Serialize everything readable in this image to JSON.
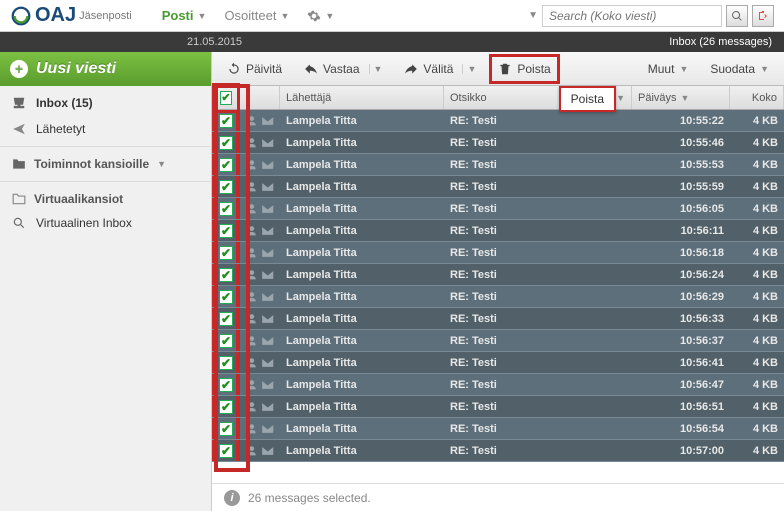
{
  "brand": {
    "name": "OAJ",
    "sub": "Jäsenposti"
  },
  "topnav": {
    "mail": "Posti",
    "contacts": "Osoitteet"
  },
  "search": {
    "placeholder": "Search (Koko viesti)"
  },
  "datebar": {
    "date": "21.05.2015",
    "status": "Inbox (26 messages)"
  },
  "compose": "Uusi viesti",
  "folders": {
    "inbox": "Inbox (15)",
    "sent": "Lähetetyt"
  },
  "sections": {
    "ops": "Toiminnot kansioille",
    "virt": "Virtuaalikansiot",
    "virt_inbox": "Virtuaalinen Inbox"
  },
  "toolbar": {
    "refresh": "Päivitä",
    "reply": "Vastaa",
    "forward": "Välitä",
    "delete": "Poista",
    "other": "Muut",
    "filter": "Suodata",
    "delete_tooltip": "Poista"
  },
  "grid": {
    "headers": {
      "from": "Lähettäjä",
      "subject": "Otsikko",
      "date": "Päiväys",
      "size": "Koko"
    },
    "rows": [
      {
        "from": "Lampela Titta",
        "subject": "RE: Testi",
        "date": "10:55:22",
        "size": "4 KB"
      },
      {
        "from": "Lampela Titta",
        "subject": "RE: Testi",
        "date": "10:55:46",
        "size": "4 KB"
      },
      {
        "from": "Lampela Titta",
        "subject": "RE: Testi",
        "date": "10:55:53",
        "size": "4 KB"
      },
      {
        "from": "Lampela Titta",
        "subject": "RE: Testi",
        "date": "10:55:59",
        "size": "4 KB"
      },
      {
        "from": "Lampela Titta",
        "subject": "RE: Testi",
        "date": "10:56:05",
        "size": "4 KB"
      },
      {
        "from": "Lampela Titta",
        "subject": "RE: Testi",
        "date": "10:56:11",
        "size": "4 KB"
      },
      {
        "from": "Lampela Titta",
        "subject": "RE: Testi",
        "date": "10:56:18",
        "size": "4 KB"
      },
      {
        "from": "Lampela Titta",
        "subject": "RE: Testi",
        "date": "10:56:24",
        "size": "4 KB"
      },
      {
        "from": "Lampela Titta",
        "subject": "RE: Testi",
        "date": "10:56:29",
        "size": "4 KB"
      },
      {
        "from": "Lampela Titta",
        "subject": "RE: Testi",
        "date": "10:56:33",
        "size": "4 KB"
      },
      {
        "from": "Lampela Titta",
        "subject": "RE: Testi",
        "date": "10:56:37",
        "size": "4 KB"
      },
      {
        "from": "Lampela Titta",
        "subject": "RE: Testi",
        "date": "10:56:41",
        "size": "4 KB"
      },
      {
        "from": "Lampela Titta",
        "subject": "RE: Testi",
        "date": "10:56:47",
        "size": "4 KB"
      },
      {
        "from": "Lampela Titta",
        "subject": "RE: Testi",
        "date": "10:56:51",
        "size": "4 KB"
      },
      {
        "from": "Lampela Titta",
        "subject": "RE: Testi",
        "date": "10:56:54",
        "size": "4 KB"
      },
      {
        "from": "Lampela Titta",
        "subject": "RE: Testi",
        "date": "10:57:00",
        "size": "4 KB"
      }
    ]
  },
  "footer": {
    "selected_text": "26 messages selected."
  }
}
